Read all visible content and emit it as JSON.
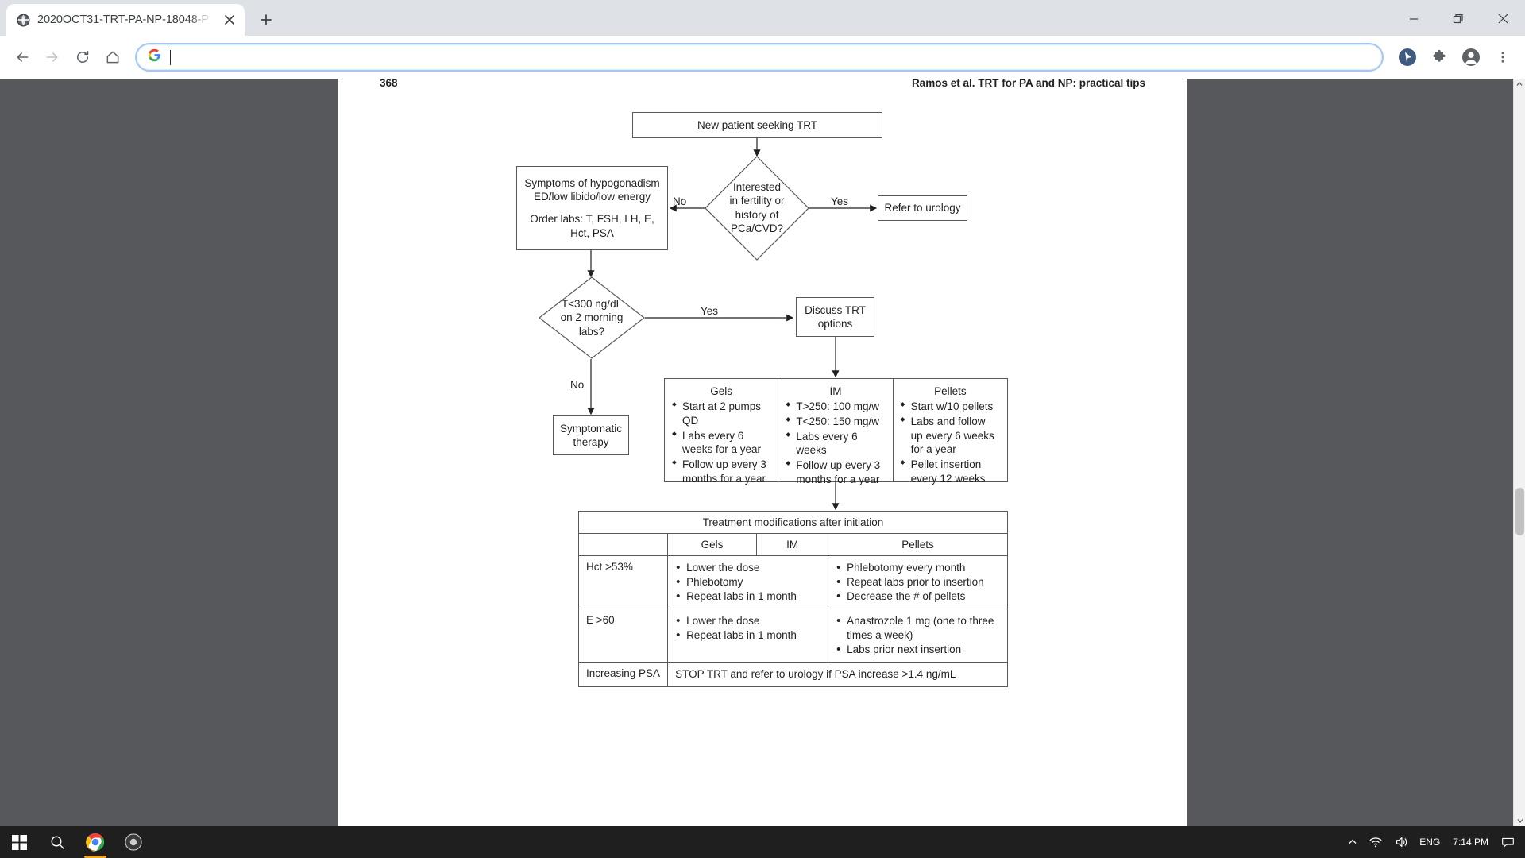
{
  "browser": {
    "tab": {
      "title": "2020OCT31-TRT-PA-NP-18048-P",
      "favicon": "globe-icon",
      "close": "close-icon"
    },
    "new_tab_label": "+",
    "window_controls": {
      "minimize": "minimize-icon",
      "maximize": "maximize-icon",
      "close": "close-icon"
    },
    "toolbar": {
      "back": "back-arrow-icon",
      "forward": "forward-arrow-icon",
      "reload": "reload-icon",
      "home": "home-icon",
      "search_engine_icon": "google-g-icon",
      "omnibox_value": "",
      "omnibox_placeholder": "",
      "cursor_badge": "cursor-extension-icon",
      "extensions": "puzzle-icon",
      "profile": "profile-avatar-icon",
      "menu": "three-dot-menu-icon"
    }
  },
  "document": {
    "running_head": {
      "page_number": "368",
      "title": "Ramos et al. TRT for PA and NP: practical tips"
    }
  },
  "flowchart": {
    "start": {
      "text": "New patient seeking TRT"
    },
    "decision1": {
      "lines": [
        "Interested",
        "in fertility or",
        "history of",
        "PCa/CVD?"
      ],
      "yes_label": "Yes",
      "no_label": "No"
    },
    "refer": {
      "text": "Refer to urology"
    },
    "symptoms": {
      "lines": [
        "Symptoms of hypogonadism",
        "ED/low libido/low energy",
        "",
        "Order labs: T, FSH, LH, E,",
        "Hct, PSA"
      ]
    },
    "decision2": {
      "lines": [
        "T<300 ng/dL",
        "on 2 morning",
        "labs?"
      ],
      "yes_label": "Yes",
      "no_label": "No"
    },
    "discuss": {
      "lines": [
        "Discuss TRT",
        "options"
      ]
    },
    "symptomatic": {
      "lines": [
        "Symptomatic",
        "therapy"
      ]
    },
    "options": [
      {
        "title": "Gels",
        "items": [
          "Start at 2 pumps QD",
          "Labs every 6 weeks for a year",
          "Follow up every 3 months for a year"
        ]
      },
      {
        "title": "IM",
        "items": [
          "T>250: 100 mg/w",
          "T<250: 150 mg/w",
          "Labs every 6 weeks",
          "Follow up every 3 months for a year"
        ]
      },
      {
        "title": "Pellets",
        "items": [
          "Start w/10 pellets",
          "Labs and follow up every 6 weeks for a year",
          "Pellet insertion every 12 weeks"
        ]
      }
    ],
    "table": {
      "title": "Treatment modifications after initiation",
      "headers": [
        "",
        "Gels",
        "IM",
        "Pellets"
      ],
      "rows": [
        {
          "label": "Hct >53%",
          "gels_im": [
            "Lower the dose",
            "Phlebotomy",
            "Repeat labs in 1 month"
          ],
          "pellets": [
            "Phlebotomy every month",
            "Repeat labs prior to insertion",
            "Decrease the # of pellets"
          ]
        },
        {
          "label": "E >60",
          "gels_im": [
            "Lower the dose",
            "Repeat labs in 1 month"
          ],
          "pellets": [
            "Anastrozole 1 mg (one to three times a week)",
            "Labs prior next insertion"
          ]
        }
      ],
      "final_row": {
        "label": "Increasing PSA",
        "text": "STOP TRT and refer to urology if PSA increase >1.4 ng/mL"
      }
    }
  },
  "taskbar": {
    "start": "windows-start-icon",
    "search": "search-icon",
    "chrome": "chrome-icon",
    "app": "app-icon",
    "tray": {
      "chevron": "show-hidden-icons-icon",
      "network": "wifi-icon",
      "volume": "speaker-icon",
      "language": "ENG",
      "time": "7:14 PM",
      "notifications": "notifications-icon"
    }
  },
  "scrollbar": {
    "up": "scroll-up-arrow",
    "down": "scroll-down-arrow"
  }
}
